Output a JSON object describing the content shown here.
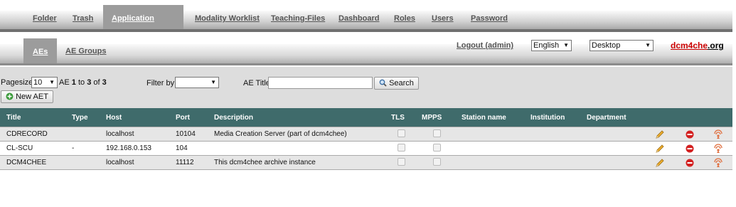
{
  "top_tabs": [
    {
      "label": "Folder"
    },
    {
      "label": "Trash"
    },
    {
      "label": "Application Entities"
    },
    {
      "label": "Modality Worklist"
    },
    {
      "label": "Teaching-Files"
    },
    {
      "label": "Dashboard"
    },
    {
      "label": "Roles"
    },
    {
      "label": "Users"
    },
    {
      "label": "Password"
    }
  ],
  "sub_tabs": [
    {
      "label": "AEs"
    },
    {
      "label": "AE Groups"
    }
  ],
  "header": {
    "logout": "Logout (admin)",
    "language": "English",
    "view": "Desktop",
    "brand_a": "dcm4che",
    "brand_b": ".org"
  },
  "filter": {
    "pagesize_label": "Pagesize",
    "pagesize_value": "10",
    "result_prefix": "AE",
    "result_from": "1",
    "result_to_word": "to",
    "result_to": "3",
    "result_of_word": "of",
    "result_total": "3",
    "filter_label": "Filter by:",
    "filter_value": "",
    "ae_title_label": "AE Title",
    "ae_title_value": "",
    "search_label": "Search",
    "new_aet_label": "New AET"
  },
  "table": {
    "columns": [
      "Title",
      "Type",
      "Host",
      "Port",
      "Description",
      "TLS",
      "MPPS",
      "Station name",
      "Institution",
      "Department"
    ],
    "rows": [
      {
        "title": "CDRECORD",
        "type": "",
        "host": "localhost",
        "port": "10104",
        "description": "Media Creation Server (part of dcm4chee)"
      },
      {
        "title": "CL-SCU",
        "type": "-",
        "host": "192.168.0.153",
        "port": "104",
        "description": ""
      },
      {
        "title": "DCM4CHEE",
        "type": "",
        "host": "localhost",
        "port": "11112",
        "description": "This dcm4chee archive instance"
      }
    ]
  },
  "icons": {
    "edit": "pencil-icon",
    "delete": "delete-icon",
    "echo": "echo-icon"
  },
  "colors": {
    "header_bg": "#3f6b6b",
    "brand_red": "#cc0000",
    "delete_red": "#d32020",
    "echo_orange": "#e07040"
  }
}
